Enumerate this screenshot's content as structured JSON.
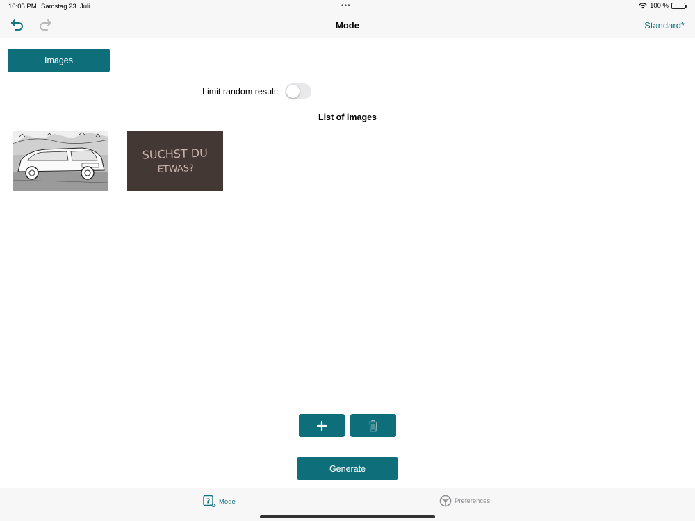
{
  "status": {
    "time": "10:05 PM",
    "date": "Samstag 23. Juli",
    "battery_text": "100 %",
    "battery_level": 1.0
  },
  "nav": {
    "title": "Mode",
    "right_label": "Standard*",
    "accent": "#13737f"
  },
  "main": {
    "images_button": "Images",
    "limit_label": "Limit random result:",
    "limit_toggle_on": false,
    "list_title": "List of images",
    "images": [
      {
        "icon": "car-sketch-image"
      },
      {
        "icon": "chalkboard-image",
        "text_line1": "SUCHST DU",
        "text_line2": "ETWAS?"
      }
    ],
    "generate_label": "Generate",
    "button_color": "#0e6f7b"
  },
  "tabs": [
    {
      "label": "Mode",
      "icon": "mode-icon",
      "active": true
    },
    {
      "label": "Preferences",
      "icon": "steering-wheel-icon",
      "active": false
    }
  ]
}
